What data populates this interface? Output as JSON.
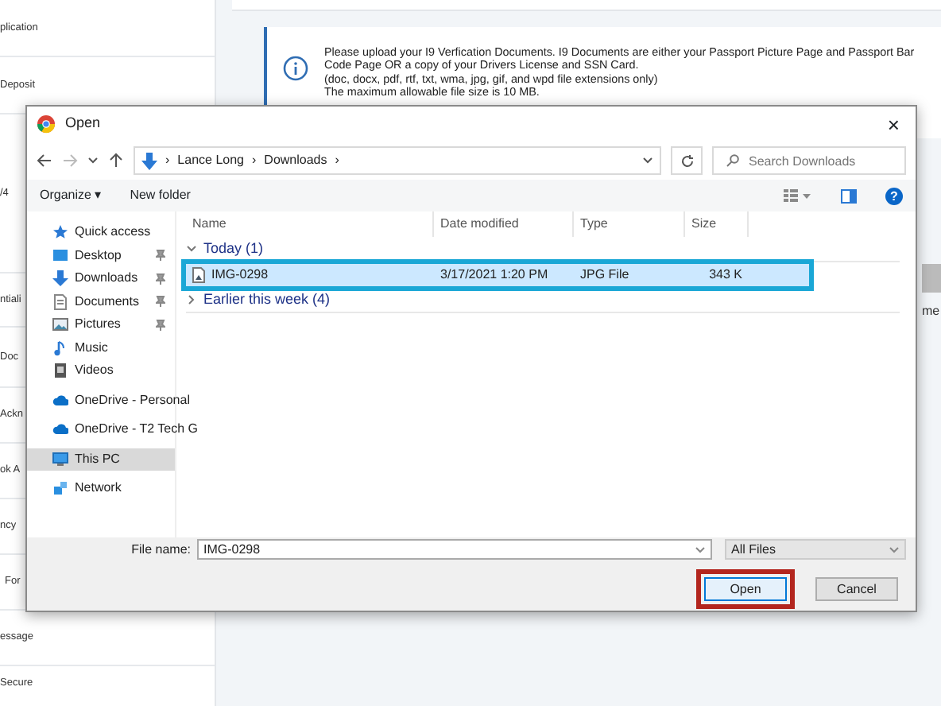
{
  "background": {
    "sidebar_items": [
      "plication",
      "Deposit",
      "/4",
      "ntiali",
      "Doc",
      "Ackn",
      "ok A",
      "ncy",
      "For",
      "essage",
      "Secure"
    ],
    "notice": {
      "sentence": "Please upload your I9 Verfication Documents. I9 Documents are either your Passport Picture Page and Passport Bar Code Page OR a copy of your Drivers License and SSN Card.",
      "lines": [
        "(doc, docx, pdf, rtf, txt, wma, jpg, gif, and wpd file extensions only)",
        "The maximum allowable file size is 10 MB."
      ]
    },
    "side_text": "me"
  },
  "dialog": {
    "title": "Open",
    "close": "×",
    "breadcrumb": [
      "Lance Long",
      "Downloads"
    ],
    "breadcrumb_separators": [
      "›",
      "›",
      "›"
    ],
    "search": {
      "placeholder": "Search Downloads"
    },
    "toolbar": {
      "organize": "Organize",
      "organize_caret": "▾",
      "new_folder": "New folder",
      "help": "?"
    },
    "nav_pane": [
      {
        "label": "Quick access",
        "kind": "star",
        "pinned": false,
        "selected": false
      },
      {
        "label": "Desktop",
        "kind": "desktop",
        "pinned": true,
        "selected": false
      },
      {
        "label": "Downloads",
        "kind": "download",
        "pinned": true,
        "selected": false
      },
      {
        "label": "Documents",
        "kind": "document",
        "pinned": true,
        "selected": false
      },
      {
        "label": "Pictures",
        "kind": "picture",
        "pinned": true,
        "selected": false
      },
      {
        "label": "Music",
        "kind": "music",
        "pinned": false,
        "selected": false
      },
      {
        "label": "Videos",
        "kind": "video",
        "pinned": false,
        "selected": false
      },
      {
        "label": "OneDrive - Personal",
        "kind": "cloud",
        "pinned": false,
        "selected": false
      },
      {
        "label": "OneDrive - T2 Tech G",
        "kind": "cloud",
        "pinned": false,
        "selected": false
      },
      {
        "label": "This PC",
        "kind": "pc",
        "pinned": false,
        "selected": true
      },
      {
        "label": "Network",
        "kind": "network",
        "pinned": false,
        "selected": false
      }
    ],
    "columns": [
      "Name",
      "Date modified",
      "Type",
      "Size"
    ],
    "groups": [
      {
        "label": "Today (1)",
        "expanded": true,
        "files": [
          {
            "name": "IMG-0298",
            "date": "3/17/2021 1:20 PM",
            "type": "JPG File",
            "size": "343 K",
            "selected": true
          }
        ]
      },
      {
        "label": "Earlier this week (4)",
        "expanded": false
      }
    ],
    "file_name_label": "File name:",
    "file_name": "IMG-0298",
    "file_type": "All Files",
    "buttons": [
      {
        "label": "Open",
        "kind": "primary",
        "highlighted": true
      },
      {
        "label": "Cancel",
        "kind": "secondary",
        "highlighted": false
      }
    ]
  }
}
